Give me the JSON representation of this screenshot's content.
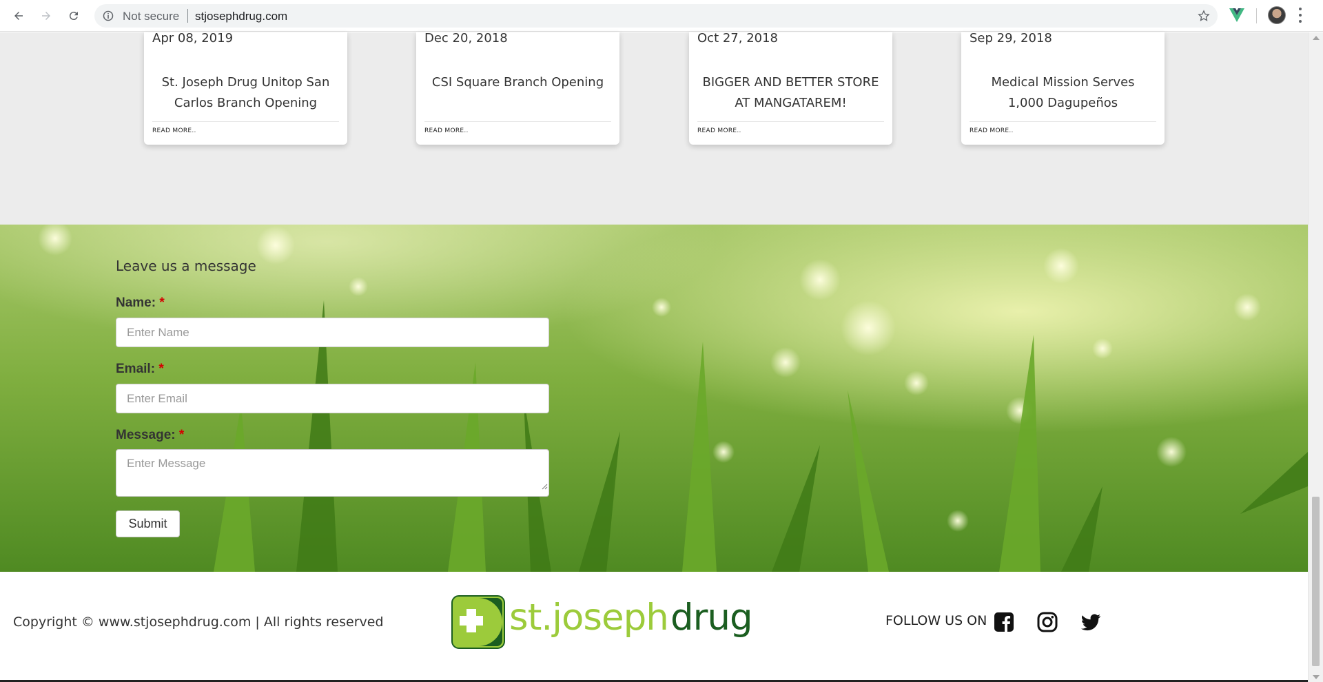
{
  "browser": {
    "security_label": "Not secure",
    "url": "stjosephdrug.com"
  },
  "news": {
    "read_more_label": "READ MORE..",
    "cards": [
      {
        "date": "Apr 08, 2019",
        "title": "St. Joseph Drug Unitop San Carlos Branch Opening"
      },
      {
        "date": "Dec 20, 2018",
        "title": "CSI Square Branch Opening"
      },
      {
        "date": "Oct 27, 2018",
        "title": "BIGGER AND BETTER STORE AT MANGATAREM!"
      },
      {
        "date": "Sep 29, 2018",
        "title": "Medical Mission Serves 1,000 Dagupeños"
      }
    ]
  },
  "contact": {
    "heading": "Leave us a message",
    "required_mark": "*",
    "name_label": "Name:",
    "name_placeholder": "Enter Name",
    "email_label": "Email:",
    "email_placeholder": "Enter Email",
    "message_label": "Message:",
    "message_placeholder": "Enter Message",
    "submit_label": "Submit"
  },
  "footer": {
    "copyright": "Copyright © www.stjosephdrug.com | All rights reserved",
    "logo_text_light": "st.joseph",
    "logo_text_dark": "drug",
    "follow_label": "FOLLOW US ON",
    "social_icons": [
      "facebook-icon",
      "instagram-icon",
      "twitter-icon"
    ]
  },
  "colors": {
    "logo_light_green": "#9ccb3b",
    "logo_dark_green": "#1b5e20",
    "required_red": "#d40000",
    "news_background": "#ececec"
  }
}
